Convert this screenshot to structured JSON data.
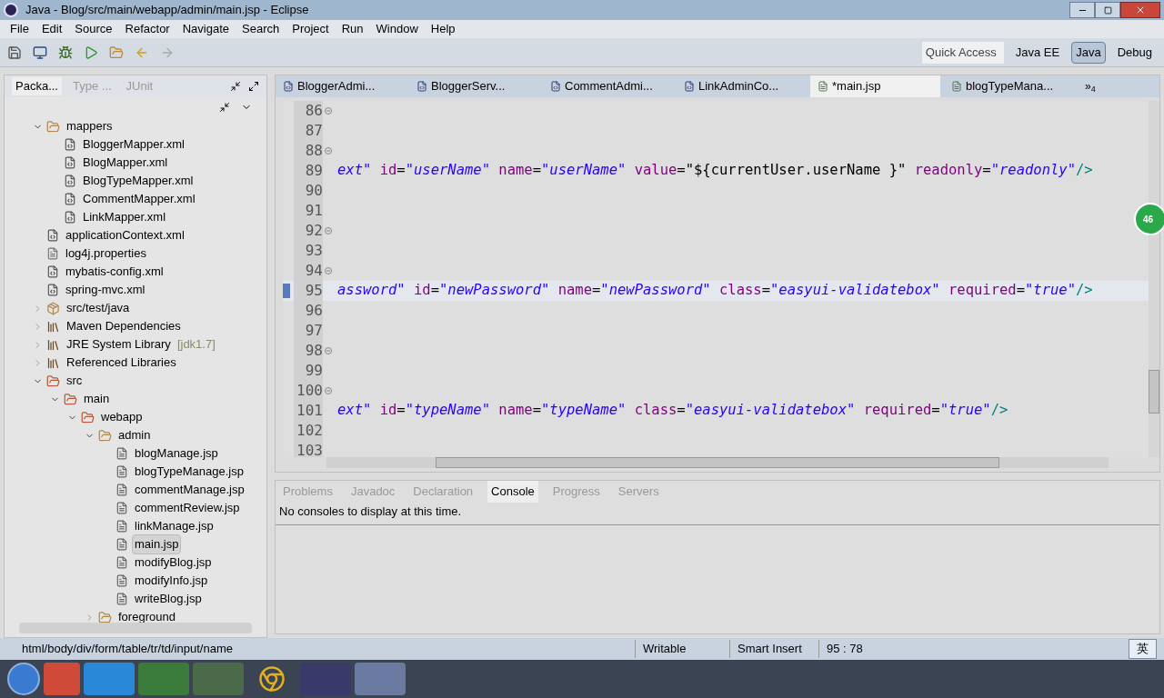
{
  "window": {
    "title": "Java - Blog/src/main/webapp/admin/main.jsp - Eclipse"
  },
  "menu": [
    "File",
    "Edit",
    "Source",
    "Refactor",
    "Navigate",
    "Search",
    "Project",
    "Run",
    "Window",
    "Help"
  ],
  "quick_access": {
    "placeholder": "Quick Access"
  },
  "perspectives": [
    {
      "label": "Java EE",
      "selected": false
    },
    {
      "label": "Java",
      "selected": true
    },
    {
      "label": "Debug",
      "selected": false
    }
  ],
  "explorer_tabs": [
    {
      "label": "Packa...",
      "selected": true
    },
    {
      "label": "Type ...",
      "selected": false
    },
    {
      "label": "JUnit",
      "selected": false
    }
  ],
  "tree": [
    {
      "label": "mappers",
      "kind": "folder",
      "expanded": true,
      "children": [
        {
          "label": "BloggerMapper.xml",
          "kind": "xml"
        },
        {
          "label": "BlogMapper.xml",
          "kind": "xml"
        },
        {
          "label": "BlogTypeMapper.xml",
          "kind": "xml"
        },
        {
          "label": "CommentMapper.xml",
          "kind": "xml"
        },
        {
          "label": "LinkMapper.xml",
          "kind": "xml"
        }
      ]
    },
    {
      "label": "applicationContext.xml",
      "kind": "xml"
    },
    {
      "label": "log4j.properties",
      "kind": "text"
    },
    {
      "label": "mybatis-config.xml",
      "kind": "xml"
    },
    {
      "label": "spring-mvc.xml",
      "kind": "xml"
    },
    {
      "label": "src/test/java",
      "kind": "package",
      "expanded": false
    },
    {
      "label": "Maven Dependencies",
      "kind": "library",
      "expanded": false
    },
    {
      "label": "JRE System Library",
      "suffix": "[jdk1.7]",
      "kind": "library",
      "expanded": false
    },
    {
      "label": "Referenced Libraries",
      "kind": "library",
      "expanded": false
    },
    {
      "label": "src",
      "kind": "webfolder",
      "expanded": true,
      "children": [
        {
          "label": "main",
          "kind": "webfolder",
          "expanded": true,
          "children": [
            {
              "label": "webapp",
              "kind": "webfolder",
              "expanded": true,
              "children": [
                {
                  "label": "admin",
                  "kind": "folder",
                  "expanded": true,
                  "children": [
                    {
                      "label": "blogManage.jsp",
                      "kind": "jsp"
                    },
                    {
                      "label": "blogTypeManage.jsp",
                      "kind": "jsp"
                    },
                    {
                      "label": "commentManage.jsp",
                      "kind": "jsp"
                    },
                    {
                      "label": "commentReview.jsp",
                      "kind": "jsp"
                    },
                    {
                      "label": "linkManage.jsp",
                      "kind": "jsp"
                    },
                    {
                      "label": "main.jsp",
                      "kind": "jsp",
                      "selected": true
                    },
                    {
                      "label": "modifyBlog.jsp",
                      "kind": "jsp"
                    },
                    {
                      "label": "modifyInfo.jsp",
                      "kind": "jsp"
                    },
                    {
                      "label": "writeBlog.jsp",
                      "kind": "jsp"
                    }
                  ]
                },
                {
                  "label": "foreground",
                  "kind": "folder",
                  "expanded": false
                }
              ]
            }
          ]
        }
      ]
    }
  ],
  "editor_tabs": [
    {
      "label": "BloggerAdmi...",
      "kind": "java",
      "selected": false
    },
    {
      "label": "BloggerServ...",
      "kind": "java",
      "selected": false
    },
    {
      "label": "CommentAdmi...",
      "kind": "java",
      "selected": false
    },
    {
      "label": "LinkAdminCo...",
      "kind": "java",
      "selected": false
    },
    {
      "label": "*main.jsp",
      "kind": "jsp",
      "selected": true
    },
    {
      "label": "blogTypeMana...",
      "kind": "jsp",
      "selected": false
    }
  ],
  "more_tabs": "»$_{4}$",
  "code_lines": [
    {
      "number": "86",
      "foldable": true,
      "current": false
    },
    {
      "number": "87",
      "foldable": false,
      "current": false
    },
    {
      "number": "88",
      "foldable": true,
      "current": false
    },
    {
      "number": "89",
      "foldable": false,
      "current": false,
      "tokens": [
        {
          "kind": "str",
          "text": "ext\""
        },
        {
          "kind": "attr",
          "text": " id"
        },
        {
          "kind": "plain",
          "text": "="
        },
        {
          "kind": "str",
          "text": "\"userName\""
        },
        {
          "kind": "attr",
          "text": " name"
        },
        {
          "kind": "plain",
          "text": "="
        },
        {
          "kind": "str",
          "text": "\"userName\""
        },
        {
          "kind": "attr",
          "text": " value"
        },
        {
          "kind": "plain",
          "text": "="
        },
        {
          "kind": "plain",
          "text": "\"${currentUser.userName }\""
        },
        {
          "kind": "attr",
          "text": " readonly"
        },
        {
          "kind": "plain",
          "text": "="
        },
        {
          "kind": "str",
          "text": "\"readonly\""
        },
        {
          "kind": "tag",
          "text": "/>"
        }
      ]
    },
    {
      "number": "90",
      "foldable": false,
      "current": false
    },
    {
      "number": "91",
      "foldable": false,
      "current": false
    },
    {
      "number": "92",
      "foldable": true,
      "current": false
    },
    {
      "number": "93",
      "foldable": false,
      "current": false
    },
    {
      "number": "94",
      "foldable": true,
      "current": false
    },
    {
      "number": "95",
      "foldable": false,
      "current": true,
      "tokens": [
        {
          "kind": "str",
          "text": "assword\""
        },
        {
          "kind": "attr",
          "text": " id"
        },
        {
          "kind": "plain",
          "text": "="
        },
        {
          "kind": "str",
          "text": "\"newPassword\""
        },
        {
          "kind": "attr",
          "text": " name"
        },
        {
          "kind": "plain",
          "text": "="
        },
        {
          "kind": "str",
          "text": "\"newPassword\""
        },
        {
          "kind": "attr",
          "text": " class"
        },
        {
          "kind": "plain",
          "text": "="
        },
        {
          "kind": "str",
          "text": "\"easyui-validatebox\""
        },
        {
          "kind": "attr",
          "text": " required"
        },
        {
          "kind": "plain",
          "text": "="
        },
        {
          "kind": "str",
          "text": "\"true\""
        },
        {
          "kind": "tag",
          "text": "/>"
        }
      ]
    },
    {
      "number": "96",
      "foldable": false,
      "current": false
    },
    {
      "number": "97",
      "foldable": false,
      "current": false
    },
    {
      "number": "98",
      "foldable": true,
      "current": false
    },
    {
      "number": "99",
      "foldable": false,
      "current": false
    },
    {
      "number": "100",
      "foldable": true,
      "current": false
    },
    {
      "number": "101",
      "foldable": false,
      "current": false,
      "tokens": [
        {
          "kind": "str",
          "text": "ext\""
        },
        {
          "kind": "attr",
          "text": " id"
        },
        {
          "kind": "plain",
          "text": "="
        },
        {
          "kind": "str",
          "text": "\"typeName\""
        },
        {
          "kind": "attr",
          "text": " name"
        },
        {
          "kind": "plain",
          "text": "="
        },
        {
          "kind": "str",
          "text": "\"typeName\""
        },
        {
          "kind": "attr",
          "text": " class"
        },
        {
          "kind": "plain",
          "text": "="
        },
        {
          "kind": "str",
          "text": "\"easyui-validatebox\""
        },
        {
          "kind": "attr",
          "text": " required"
        },
        {
          "kind": "plain",
          "text": "="
        },
        {
          "kind": "str",
          "text": "\"true\""
        },
        {
          "kind": "tag",
          "text": "/>"
        }
      ]
    },
    {
      "number": "102",
      "foldable": false,
      "current": false
    },
    {
      "number": "103",
      "foldable": false,
      "current": false
    }
  ],
  "badge": "46",
  "bottom_tabs": [
    {
      "label": "Problems",
      "selected": false
    },
    {
      "label": "Javadoc",
      "selected": false
    },
    {
      "label": "Declaration",
      "selected": false
    },
    {
      "label": "Console",
      "selected": true
    },
    {
      "label": "Progress",
      "selected": false
    },
    {
      "label": "Servers",
      "selected": false
    }
  ],
  "console_message": "No consoles to display at this time.",
  "status_bar": {
    "path": "html/body/div/form/table/tr/td/input/name",
    "mode": "Writable",
    "insert": "Smart Insert",
    "position": "95 : 78",
    "ime": "英"
  }
}
